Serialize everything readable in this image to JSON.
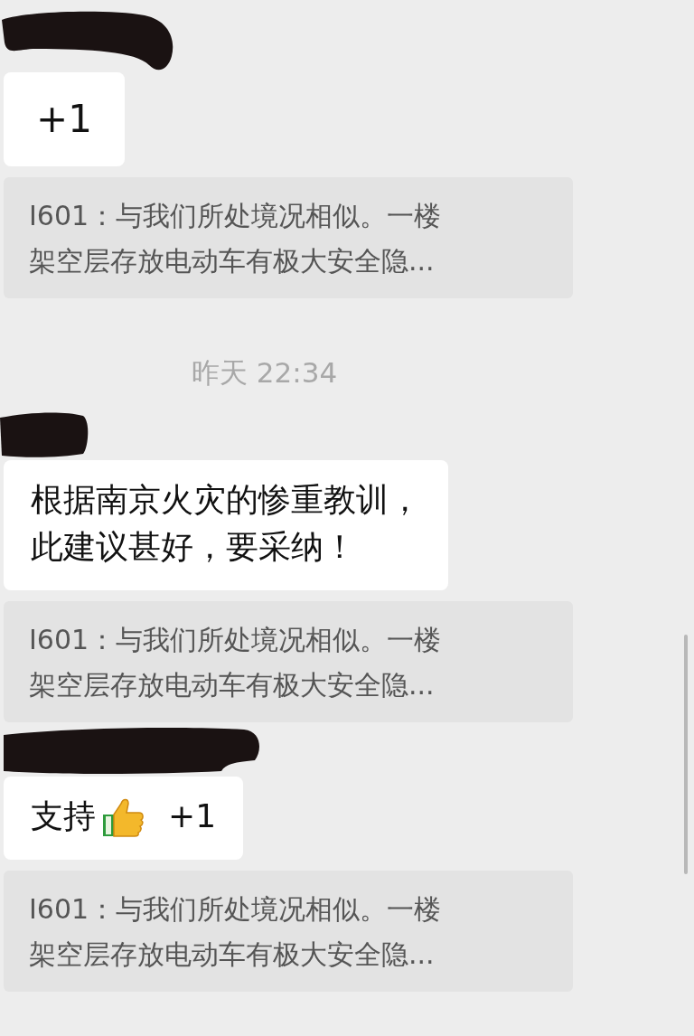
{
  "messages": [
    {
      "kind": "message",
      "parts": [
        {
          "kind": "text",
          "text": "+1"
        }
      ],
      "quote": [
        "I601：与我们所处境况相似。一楼",
        "架空层存放电动车有极大安全隐..."
      ]
    },
    {
      "kind": "time",
      "text": "昨天 22:34"
    },
    {
      "kind": "message",
      "parts": [
        {
          "kind": "text",
          "text": "根据南京火灾的惨重教训，"
        },
        {
          "kind": "text",
          "text": "此建议甚好，要采纳！"
        }
      ],
      "quote": [
        "I601：与我们所处境况相似。一楼",
        "架空层存放电动车有极大安全隐..."
      ]
    },
    {
      "kind": "message",
      "parts": [
        {
          "kind": "text",
          "text": "支持"
        },
        {
          "kind": "thumb"
        },
        {
          "kind": "text",
          "text": "+1"
        }
      ],
      "quote": [
        "I601：与我们所处境况相似。一楼",
        "架空层存放电动车有极大安全隐..."
      ]
    }
  ]
}
